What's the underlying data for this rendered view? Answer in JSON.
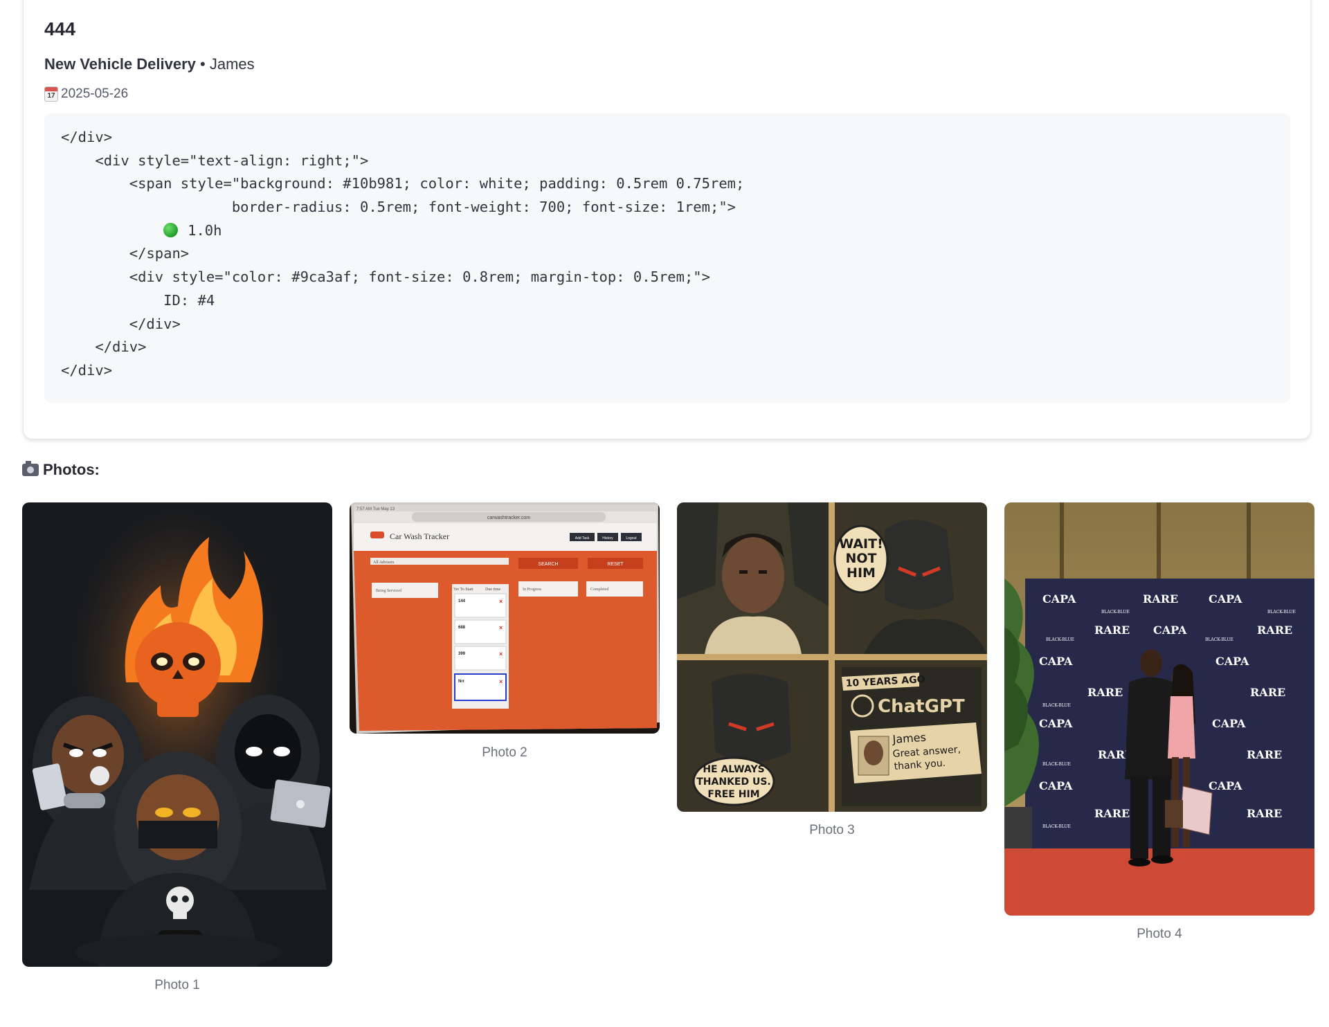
{
  "task": {
    "id": "444",
    "name": "New Vehicle Delivery",
    "separator": " • ",
    "person": "James",
    "date": "2025-05-26",
    "date_icon": "calendar-icon",
    "calendar_glyph_day": "17"
  },
  "code": {
    "lines": [
      "</div>",
      "    <div style=\"text-align: right;\">",
      "        <span style=\"background: #10b981; color: white; padding: 0.5rem 0.75rem;",
      "                    border-radius: 0.5rem; font-weight: 700; font-size: 1rem;\">",
      "1.0h",
      "        </span>",
      "        <div style=\"color: #9ca3af; font-size: 0.8rem; margin-top: 0.5rem;\">",
      "            ID: #4",
      "        </div>",
      "    </div>",
      "</div>"
    ],
    "hours_prefix": "            ",
    "hours_icon": "green-circle-icon"
  },
  "photos": {
    "heading": "Photos:",
    "heading_icon": "camera-icon",
    "items": [
      {
        "caption": "Photo 1"
      },
      {
        "caption": "Photo 2",
        "screen_title": "Car Wash Tracker",
        "screen_url": "carwashtracker.com",
        "status_bar_time": "7:57 AM   Tue May 13",
        "buttons": [
          "Add Task",
          "History",
          "Logout"
        ],
        "filter_value": "All Advisors",
        "search_label": "SEARCH",
        "reset_label": "RESET",
        "columns": [
          "Being Serviced",
          "Yet To Start",
          "Due time",
          "In Progress",
          "Completed"
        ],
        "rows": [
          "144",
          "688",
          "399",
          "Nrr"
        ]
      },
      {
        "caption": "Photo 3",
        "bubble_1": [
          "WAIT!",
          "NOT",
          "HIM"
        ],
        "bubble_2": [
          "HE ALWAYS",
          "THANKED US.",
          "FREE HIM"
        ],
        "banner": "10 YEARS AGO",
        "brand": "ChatGPT",
        "card_name": "James",
        "card_text": [
          "Great answer,",
          "thank you."
        ]
      },
      {
        "caption": "Photo 4",
        "backdrop_words": [
          "CAPA",
          "RARE",
          "BLACK-BLUE"
        ]
      }
    ]
  }
}
